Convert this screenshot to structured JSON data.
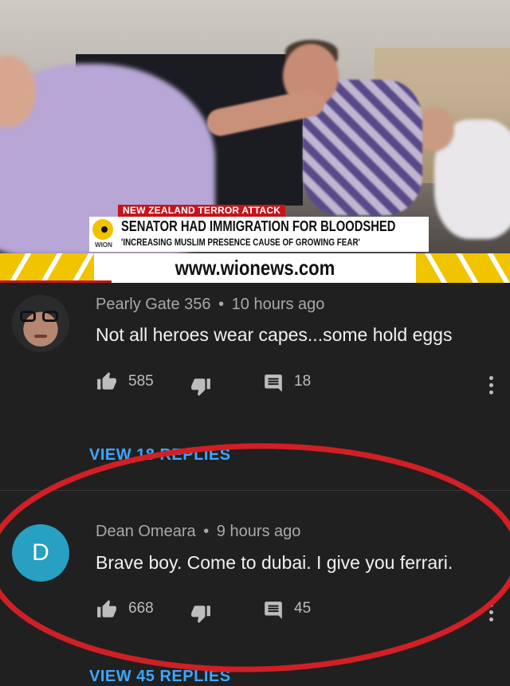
{
  "video": {
    "lower_third": {
      "label": "NEW ZEALAND TERROR ATTACK",
      "headline": "SENATOR HAD IMMIGRATION FOR BLOODSHED",
      "subheadline": "'INCREASING MUSLIM PRESENCE CAUSE OF GROWING FEAR'",
      "logo_text": "WION",
      "url": "www.wionews.com"
    }
  },
  "comments": [
    {
      "author": "Pearly Gate 356",
      "time": "10 hours ago",
      "text": "Not all heroes wear capes...some hold eggs",
      "likes": "585",
      "replies": "18",
      "view_replies": "VIEW 18 REPLIES"
    },
    {
      "author": "Dean Omeara",
      "time": "9 hours ago",
      "avatar_letter": "D",
      "text": "Brave boy. Come to dubai. I give you ferrari.",
      "likes": "668",
      "replies": "45",
      "view_replies": "VIEW 45 REPLIES"
    }
  ],
  "separator": "•",
  "colors": {
    "background": "#202020",
    "link": "#3ea6ff",
    "avatar_d": "#27a0c2",
    "highlight_ellipse": "#d11f26",
    "wion_red": "#c4151c",
    "wion_yellow": "#f1c400"
  },
  "icons": [
    "thumbs-up-icon",
    "thumbs-down-icon",
    "reply-icon",
    "more-vert-icon"
  ]
}
